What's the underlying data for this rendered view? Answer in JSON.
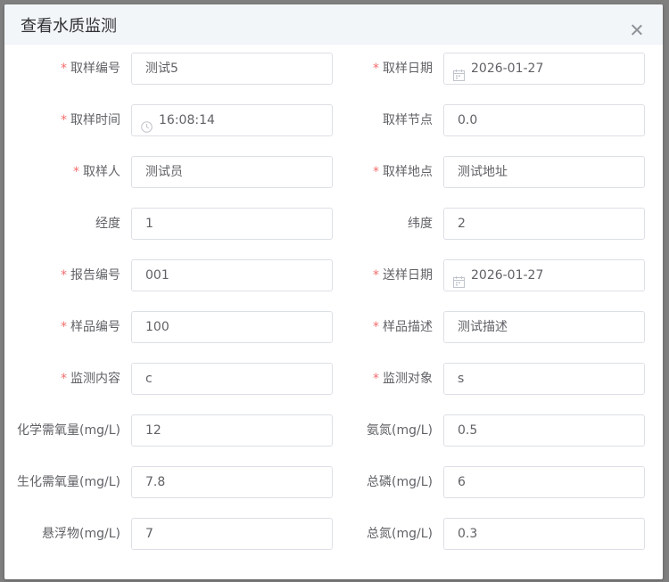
{
  "dialog": {
    "title": "查看水质监测"
  },
  "rows": [
    {
      "left": {
        "label": "取样编号",
        "required": "*",
        "value": "测试5"
      },
      "right": {
        "label": "取样日期",
        "required": "*",
        "value": "2026-01-27",
        "icon": "calendar-icon"
      }
    },
    {
      "left": {
        "label": "取样时间",
        "required": "*",
        "value": "16:08:14",
        "icon": "clock-icon"
      },
      "right": {
        "label": "取样节点",
        "required": "",
        "value": "0.0"
      }
    },
    {
      "left": {
        "label": "取样人",
        "required": "*",
        "value": "测试员"
      },
      "right": {
        "label": "取样地点",
        "required": "*",
        "value": "测试地址"
      }
    },
    {
      "left": {
        "label": "经度",
        "required": "",
        "value": "1"
      },
      "right": {
        "label": "纬度",
        "required": "",
        "value": "2"
      }
    },
    {
      "left": {
        "label": "报告编号",
        "required": "*",
        "value": "001"
      },
      "right": {
        "label": "送样日期",
        "required": "*",
        "value": "2026-01-27",
        "icon": "calendar-icon"
      }
    },
    {
      "left": {
        "label": "样品编号",
        "required": "*",
        "value": "100"
      },
      "right": {
        "label": "样品描述",
        "required": "*",
        "value": "测试描述"
      }
    },
    {
      "left": {
        "label": "监测内容",
        "required": "*",
        "value": "c"
      },
      "right": {
        "label": "监测对象",
        "required": "*",
        "value": "s"
      }
    },
    {
      "left": {
        "label": "化学需氧量(mg/L)",
        "required": "",
        "value": "12"
      },
      "right": {
        "label": "氨氮(mg/L)",
        "required": "",
        "value": "0.5"
      }
    },
    {
      "left": {
        "label": "生化需氧量(mg/L)",
        "required": "",
        "value": "7.8"
      },
      "right": {
        "label": "总磷(mg/L)",
        "required": "",
        "value": "6"
      }
    },
    {
      "left": {
        "label": "悬浮物(mg/L)",
        "required": "",
        "value": "7"
      },
      "right": {
        "label": "总氮(mg/L)",
        "required": "",
        "value": "0.3"
      }
    }
  ],
  "colors": {
    "required": "#f56c6c",
    "label": "#606266",
    "border": "#dcdfe6",
    "header_bg": "#f3f6f9",
    "overlay": "#7f7f7f"
  }
}
